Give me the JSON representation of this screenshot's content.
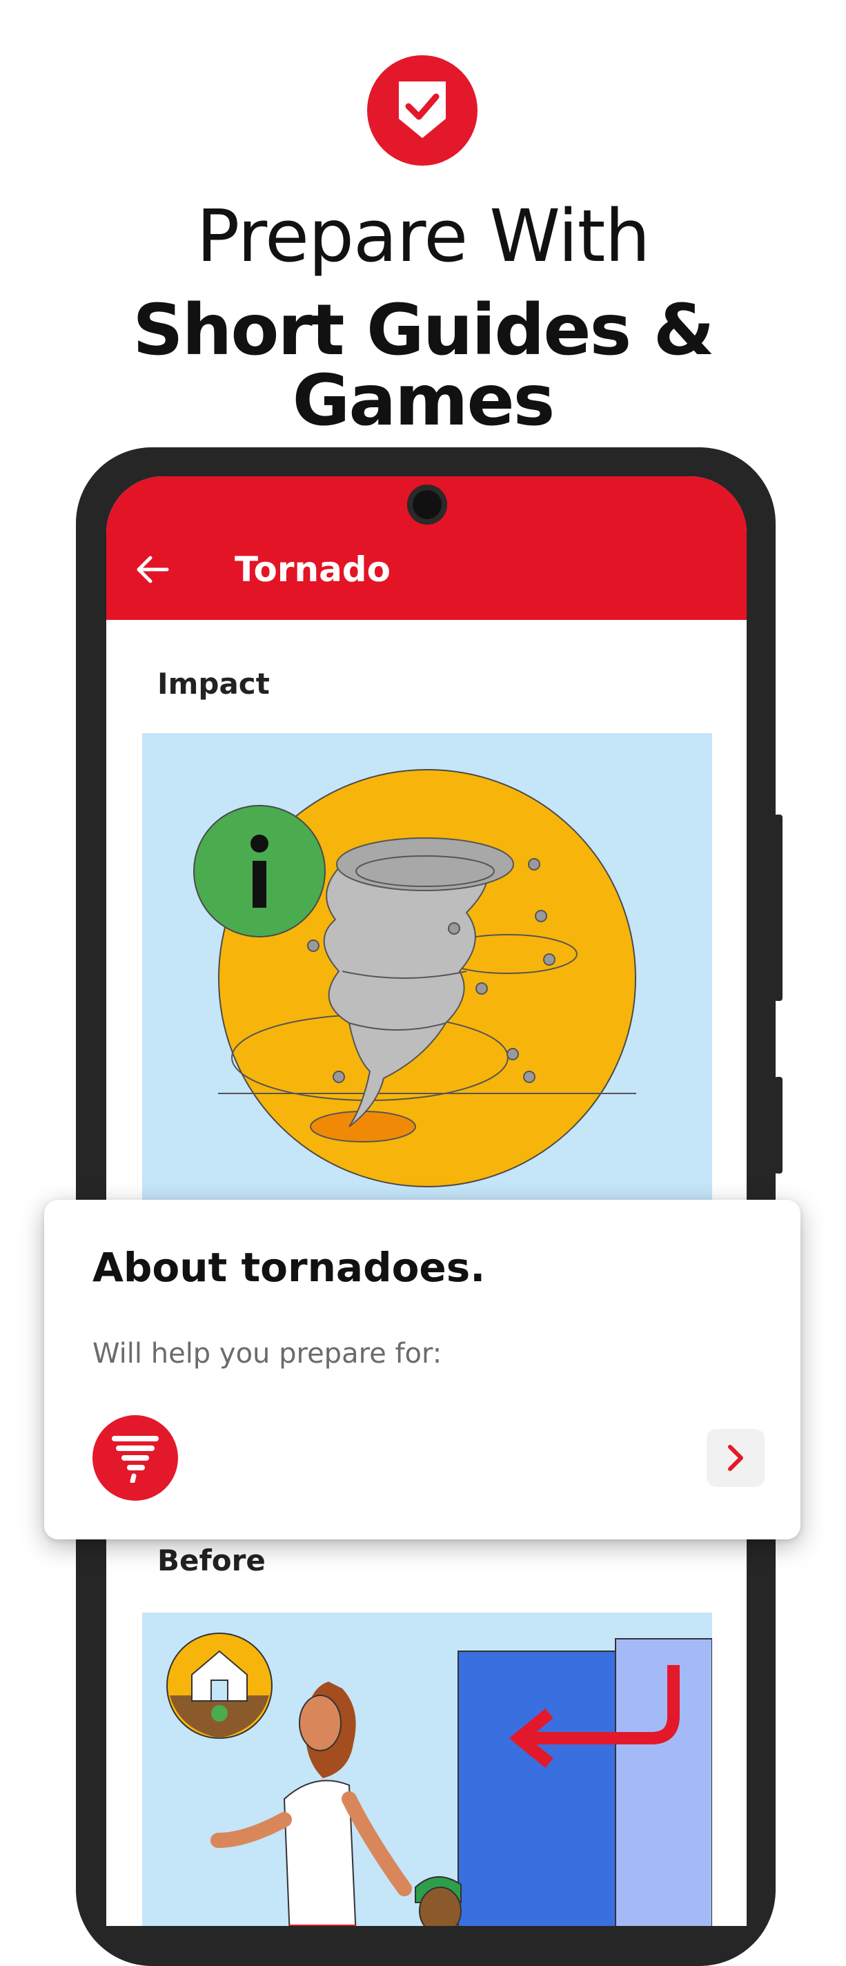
{
  "header": {
    "line1": "Prepare With",
    "line2": "Short Guides & Games",
    "badge_icon": "shield-check-icon"
  },
  "app": {
    "title": "Tornado",
    "back_icon": "arrow-left-icon",
    "accent_color": "#e31426"
  },
  "sections": {
    "impact": {
      "label": "Impact"
    },
    "before": {
      "label": "Before"
    }
  },
  "card": {
    "title": "About tornadoes.",
    "subtitle": "Will help you prepare for:",
    "hazard_icon": "tornado-icon",
    "action_icon": "chevron-right-icon"
  }
}
